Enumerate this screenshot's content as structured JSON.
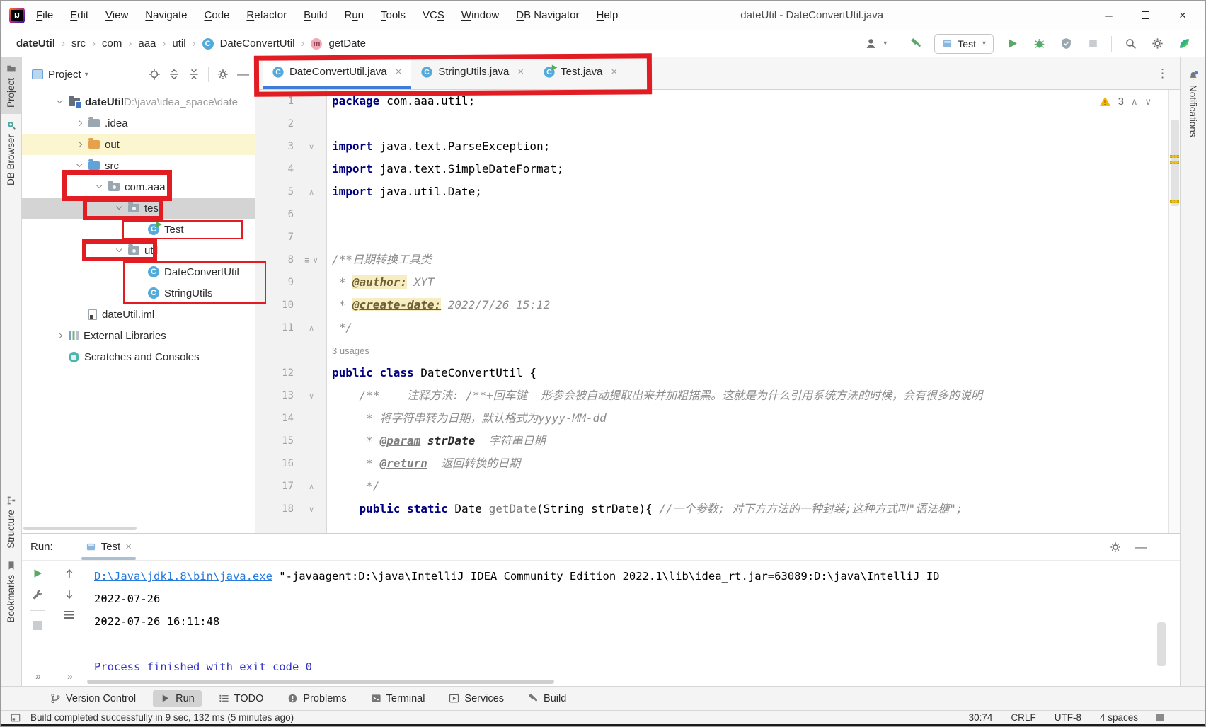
{
  "window": {
    "title": "dateUtil - DateConvertUtil.java",
    "menus": [
      {
        "label": "File",
        "m": 0
      },
      {
        "label": "Edit",
        "m": 0
      },
      {
        "label": "View",
        "m": 0
      },
      {
        "label": "Navigate",
        "m": 0
      },
      {
        "label": "Code",
        "m": 0
      },
      {
        "label": "Refactor",
        "m": 0
      },
      {
        "label": "Build",
        "m": 0
      },
      {
        "label": "Run",
        "m": 1
      },
      {
        "label": "Tools",
        "m": 0
      },
      {
        "label": "VCS",
        "m": 2
      },
      {
        "label": "Window",
        "m": 0
      },
      {
        "label": "DB Navigator",
        "m": 0
      },
      {
        "label": "Help",
        "m": 0
      }
    ],
    "controls": {
      "minimize": "–",
      "close": "×"
    }
  },
  "breadcrumbs": [
    {
      "label": "dateUtil",
      "bold": true
    },
    {
      "label": "src"
    },
    {
      "label": "com"
    },
    {
      "label": "aaa"
    },
    {
      "label": "util"
    },
    {
      "label": "DateConvertUtil",
      "icon": "class"
    },
    {
      "label": "getDate",
      "icon": "method"
    }
  ],
  "toolbar": {
    "run_config": "Test"
  },
  "stripes": {
    "left_top": [
      {
        "label": "Project",
        "icon": "folder",
        "active": true
      },
      {
        "label": "DB Browser",
        "icon": "db"
      }
    ],
    "left_bottom": [
      {
        "label": "Structure",
        "icon": "structure"
      },
      {
        "label": "Bookmarks",
        "icon": "bookmark"
      }
    ],
    "right": [
      {
        "label": "Notifications",
        "icon": "bell"
      }
    ]
  },
  "project_panel": {
    "title": "Project",
    "tree": [
      {
        "label": "dateUtil",
        "suffix": " D:\\java\\idea_space\\date",
        "icon": "project",
        "chev": "down",
        "depth": 0,
        "bold": true
      },
      {
        "label": ".idea",
        "icon": "folder",
        "chev": "right",
        "depth": 1
      },
      {
        "label": "out",
        "icon": "folder-orange",
        "chev": "right",
        "depth": 1,
        "row": "yellow"
      },
      {
        "label": "src",
        "icon": "folder-blue",
        "chev": "down",
        "depth": 1
      },
      {
        "label": "com.aaa",
        "icon": "package",
        "chev": "down",
        "depth": 2
      },
      {
        "label": "test",
        "icon": "package",
        "chev": "down",
        "depth": 3,
        "row": "selected"
      },
      {
        "label": "Test",
        "icon": "class-run",
        "depth": 4
      },
      {
        "label": "util",
        "icon": "package",
        "chev": "down",
        "depth": 3
      },
      {
        "label": "DateConvertUtil",
        "icon": "class",
        "depth": 4
      },
      {
        "label": "StringUtils",
        "icon": "class",
        "depth": 4
      },
      {
        "label": "dateUtil.iml",
        "icon": "file",
        "depth": 1
      },
      {
        "label": "External Libraries",
        "icon": "libraries",
        "chev": "right",
        "depth": 0
      },
      {
        "label": "Scratches and Consoles",
        "icon": "scratches",
        "depth": 0
      }
    ]
  },
  "tabs": [
    {
      "label": "DateConvertUtil.java",
      "icon": "class",
      "active": true
    },
    {
      "label": "StringUtils.java",
      "icon": "class",
      "active": false
    },
    {
      "label": "Test.java",
      "icon": "class-run",
      "active": false
    }
  ],
  "editor": {
    "warning_count": "3",
    "usages_inlay": "3 usages",
    "lines": [
      {
        "n": "1",
        "fold": "",
        "seg": [
          [
            "kw",
            "package"
          ],
          [
            "pl",
            " com.aaa.util;"
          ]
        ]
      },
      {
        "n": "2",
        "fold": "",
        "seg": []
      },
      {
        "n": "3",
        "fold": "down",
        "seg": [
          [
            "kw",
            "import"
          ],
          [
            "pl",
            " java.text.ParseException;"
          ]
        ]
      },
      {
        "n": "4",
        "fold": "",
        "seg": [
          [
            "kw",
            "import"
          ],
          [
            "pl",
            " java.text.SimpleDateFormat;"
          ]
        ]
      },
      {
        "n": "5",
        "fold": "up",
        "seg": [
          [
            "kw",
            "import"
          ],
          [
            "pl",
            " java.util.Date;"
          ]
        ]
      },
      {
        "n": "6",
        "fold": "",
        "seg": []
      },
      {
        "n": "7",
        "fold": "",
        "seg": []
      },
      {
        "n": "8",
        "fold": "down",
        "sort": true,
        "seg": [
          [
            "doc",
            "/**日期转换工具类"
          ]
        ]
      },
      {
        "n": "9",
        "fold": "",
        "seg": [
          [
            "doc",
            " * "
          ],
          [
            "taghl",
            "@author:"
          ],
          [
            "doc",
            " XYT"
          ]
        ]
      },
      {
        "n": "10",
        "fold": "",
        "seg": [
          [
            "doc",
            " * "
          ],
          [
            "taghl",
            "@create-date:"
          ],
          [
            "doc",
            " 2022/7/26 15:12"
          ]
        ]
      },
      {
        "n": "11",
        "fold": "up",
        "seg": [
          [
            "doc",
            " */"
          ]
        ]
      },
      {
        "inlay": true
      },
      {
        "n": "12",
        "fold": "",
        "seg": [
          [
            "kw",
            "public"
          ],
          [
            "pl",
            " "
          ],
          [
            "kw",
            "class"
          ],
          [
            "pl",
            " DateConvertUtil {"
          ]
        ]
      },
      {
        "n": "13",
        "fold": "down",
        "seg": [
          [
            "pl",
            "    "
          ],
          [
            "doc",
            "/**    注释方法: /**+回车键  形参会被自动提取出来并加粗描黑。这就是为什么引用系统方法的时候，会有很多的说明"
          ]
        ]
      },
      {
        "n": "14",
        "fold": "",
        "seg": [
          [
            "doc",
            "     * 将字符串转为日期，默认格式为yyyy-MM-dd"
          ]
        ]
      },
      {
        "n": "15",
        "fold": "",
        "seg": [
          [
            "doc",
            "     * "
          ],
          [
            "tag",
            "@param"
          ],
          [
            "docb",
            " strDate"
          ],
          [
            "doc",
            "  字符串日期"
          ]
        ]
      },
      {
        "n": "16",
        "fold": "",
        "seg": [
          [
            "doc",
            "     * "
          ],
          [
            "tag",
            "@return"
          ],
          [
            "doc",
            "  返回转换的日期"
          ]
        ]
      },
      {
        "n": "17",
        "fold": "up",
        "seg": [
          [
            "doc",
            "     */"
          ]
        ]
      },
      {
        "n": "18",
        "fold": "down",
        "seg": [
          [
            "pl",
            "    "
          ],
          [
            "kw",
            "public static"
          ],
          [
            "pl",
            " Date "
          ],
          [
            "meth",
            "getDate"
          ],
          [
            "pl",
            "(String strDate){ "
          ],
          [
            "doc",
            "//一个参数; 对下方方法的一种封装;这种方式叫\"语法糖\";"
          ]
        ]
      }
    ]
  },
  "run_panel": {
    "label": "Run:",
    "tab": "Test",
    "console": [
      {
        "seg": [
          [
            "link",
            "D:\\Java\\jdk1.8\\bin\\java.exe"
          ],
          [
            "pl",
            " \"-javaagent:D:\\java\\IntelliJ IDEA Community Edition 2022.1\\lib\\idea_rt.jar=63089:D:\\java\\IntelliJ ID"
          ]
        ]
      },
      {
        "seg": [
          [
            "pl",
            "2022-07-26"
          ]
        ]
      },
      {
        "seg": [
          [
            "pl",
            "2022-07-26 16:11:48"
          ]
        ]
      },
      {
        "seg": []
      },
      {
        "seg": [
          [
            "sys",
            "Process finished with exit code 0"
          ]
        ]
      }
    ]
  },
  "tool_window_bar": [
    {
      "label": "Version Control",
      "icon": "branch",
      "active": false
    },
    {
      "label": "Run",
      "icon": "play",
      "active": true
    },
    {
      "label": "TODO",
      "icon": "todo",
      "active": false
    },
    {
      "label": "Problems",
      "icon": "problems",
      "active": false
    },
    {
      "label": "Terminal",
      "icon": "terminal",
      "active": false
    },
    {
      "label": "Services",
      "icon": "services",
      "active": false
    },
    {
      "label": "Build",
      "icon": "build",
      "active": false
    }
  ],
  "status_bar": {
    "message": "Build completed successfully in 9 sec, 132 ms (5 minutes ago)",
    "position": "30:74",
    "line_sep": "CRLF",
    "encoding": "UTF-8",
    "indent": "4 spaces"
  },
  "colors": {
    "annotation": "#e11d23",
    "accent_blue": "#3d7dd8",
    "run_green": "#59a869",
    "warning_yellow": "#f2b600"
  }
}
